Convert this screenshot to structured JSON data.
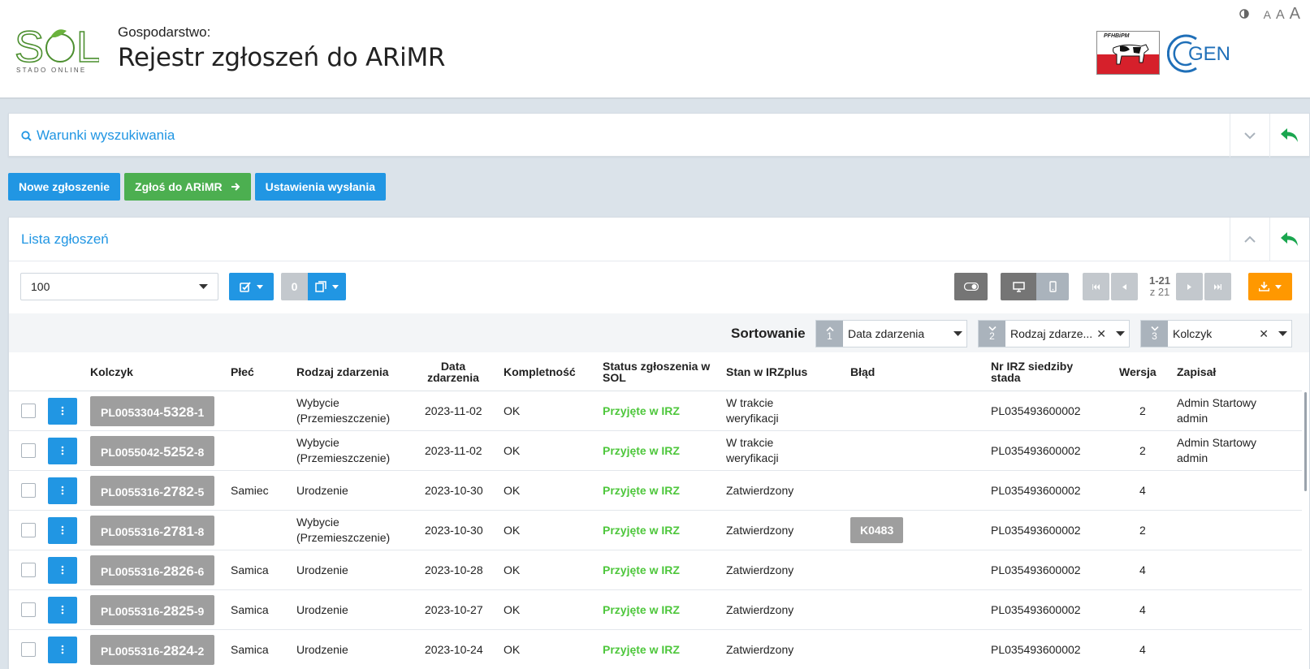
{
  "header": {
    "logo_text": "SOL",
    "logo_subtitle": "STADO ONLINE",
    "farm_label": "Gospodarstwo:",
    "page_title": "Rejestr zgłoszeń do ARiMR",
    "accessibility": {
      "contrast_icon": "contrast-icon",
      "font_small": "A",
      "font_medium": "A",
      "font_large": "A"
    },
    "partner_logo_text": "PFHBiPM",
    "gen_logo_text": "GEN"
  },
  "search_panel": {
    "title": "Warunki wyszukiwania"
  },
  "actions": {
    "new_report": "Nowe zgłoszenie",
    "report_arimr": "Zgłoś do ARiMR",
    "send_settings": "Ustawienia wysłania"
  },
  "list_panel": {
    "title": "Lista zgłoszeń",
    "page_size": "100",
    "selected_count": "0",
    "pager": {
      "range": "1-21",
      "total": "z 21"
    }
  },
  "sorting": {
    "label": "Sortowanie",
    "items": [
      {
        "num": "1",
        "text": "Data zdarzenia",
        "clearable": false
      },
      {
        "num": "2",
        "text": "Rodzaj zdarze...",
        "clearable": true
      },
      {
        "num": "3",
        "text": "Kolczyk",
        "clearable": true
      }
    ]
  },
  "table": {
    "columns": {
      "tag": "Kolczyk",
      "sex": "Płeć",
      "event": "Rodzaj zdarzenia",
      "date": "Data zdarzenia",
      "completeness": "Kompletność",
      "status": "Status zgłoszenia w SOL",
      "irz_state": "Stan w IRZplus",
      "error": "Błąd",
      "irz_no": "Nr IRZ siedziby stada",
      "version": "Wersja",
      "saved_by": "Zapisał"
    },
    "rows": [
      {
        "tag_prefix": "PL0053304-",
        "tag_main": "5328",
        "tag_suffix": "-1",
        "sex": "",
        "event": "Wybycie (Przemieszczenie)",
        "date": "2023-11-02",
        "completeness": "OK",
        "status": "Przyjęte w IRZ",
        "irz_state": "W trakcie weryfikacji",
        "error": "",
        "irz_no": "PL035493600002",
        "version": "2",
        "saved_by": "Admin Startowy admin"
      },
      {
        "tag_prefix": "PL0055042-",
        "tag_main": "5252",
        "tag_suffix": "-8",
        "sex": "",
        "event": "Wybycie (Przemieszczenie)",
        "date": "2023-11-02",
        "completeness": "OK",
        "status": "Przyjęte w IRZ",
        "irz_state": "W trakcie weryfikacji",
        "error": "",
        "irz_no": "PL035493600002",
        "version": "2",
        "saved_by": "Admin Startowy admin"
      },
      {
        "tag_prefix": "PL0055316-",
        "tag_main": "2782",
        "tag_suffix": "-5",
        "sex": "Samiec",
        "event": "Urodzenie",
        "date": "2023-10-30",
        "completeness": "OK",
        "status": "Przyjęte w IRZ",
        "irz_state": "Zatwierdzony",
        "error": "",
        "irz_no": "PL035493600002",
        "version": "4",
        "saved_by": ""
      },
      {
        "tag_prefix": "PL0055316-",
        "tag_main": "2781",
        "tag_suffix": "-8",
        "sex": "",
        "event": "Wybycie (Przemieszczenie)",
        "date": "2023-10-30",
        "completeness": "OK",
        "status": "Przyjęte w IRZ",
        "irz_state": "Zatwierdzony",
        "error": "K0483",
        "irz_no": "PL035493600002",
        "version": "2",
        "saved_by": ""
      },
      {
        "tag_prefix": "PL0055316-",
        "tag_main": "2826",
        "tag_suffix": "-6",
        "sex": "Samica",
        "event": "Urodzenie",
        "date": "2023-10-28",
        "completeness": "OK",
        "status": "Przyjęte w IRZ",
        "irz_state": "Zatwierdzony",
        "error": "",
        "irz_no": "PL035493600002",
        "version": "4",
        "saved_by": ""
      },
      {
        "tag_prefix": "PL0055316-",
        "tag_main": "2825",
        "tag_suffix": "-9",
        "sex": "Samica",
        "event": "Urodzenie",
        "date": "2023-10-27",
        "completeness": "OK",
        "status": "Przyjęte w IRZ",
        "irz_state": "Zatwierdzony",
        "error": "",
        "irz_no": "PL035493600002",
        "version": "4",
        "saved_by": ""
      },
      {
        "tag_prefix": "PL0055316-",
        "tag_main": "2824",
        "tag_suffix": "-2",
        "sex": "Samica",
        "event": "Urodzenie",
        "date": "2023-10-24",
        "completeness": "OK",
        "status": "Przyjęte w IRZ",
        "irz_state": "Zatwierdzony",
        "error": "",
        "irz_no": "PL035493600002",
        "version": "4",
        "saved_by": ""
      }
    ]
  },
  "colors": {
    "primary": "#2196e3",
    "success": "#4caf50",
    "status_ok": "#4ec73c",
    "export": "#ff9800",
    "tag_gray": "#9e9e9e"
  }
}
